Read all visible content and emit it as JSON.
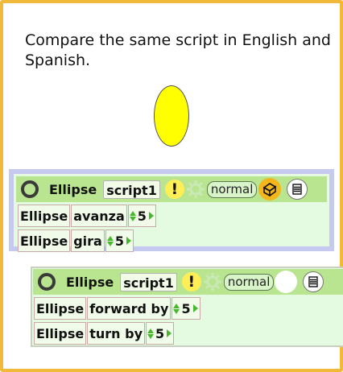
{
  "caption": "Compare the same script in English and Spanish.",
  "colors": {
    "frame": "#f0b93a",
    "ellipse_fill": "#ffff00",
    "header": "#b9e590",
    "panel_bg": "#e5fbe1",
    "spanish_border": "#c6c9f0",
    "arrow_green": "#45b82b"
  },
  "spanish_script": {
    "object": "Ellipse",
    "script_name": "script1",
    "bang": "!",
    "status": "normal",
    "icons": [
      "halo-circle-icon",
      "exclamation-icon",
      "gear-icon",
      "shape-icon",
      "menu-icon"
    ],
    "tiles": [
      {
        "object": "Ellipse",
        "command": "avanza",
        "value": "5"
      },
      {
        "object": "Ellipse",
        "command": "gira",
        "value": "5"
      }
    ]
  },
  "english_script": {
    "object": "Ellipse",
    "script_name": "script1",
    "bang": "!",
    "status": "normal",
    "icons": [
      "halo-circle-icon",
      "exclamation-icon",
      "gear-icon",
      "blank-circle-icon",
      "menu-icon"
    ],
    "tiles": [
      {
        "object": "Ellipse",
        "command": "forward by",
        "value": "5"
      },
      {
        "object": "Ellipse",
        "command": "turn by",
        "value": "5"
      }
    ]
  }
}
